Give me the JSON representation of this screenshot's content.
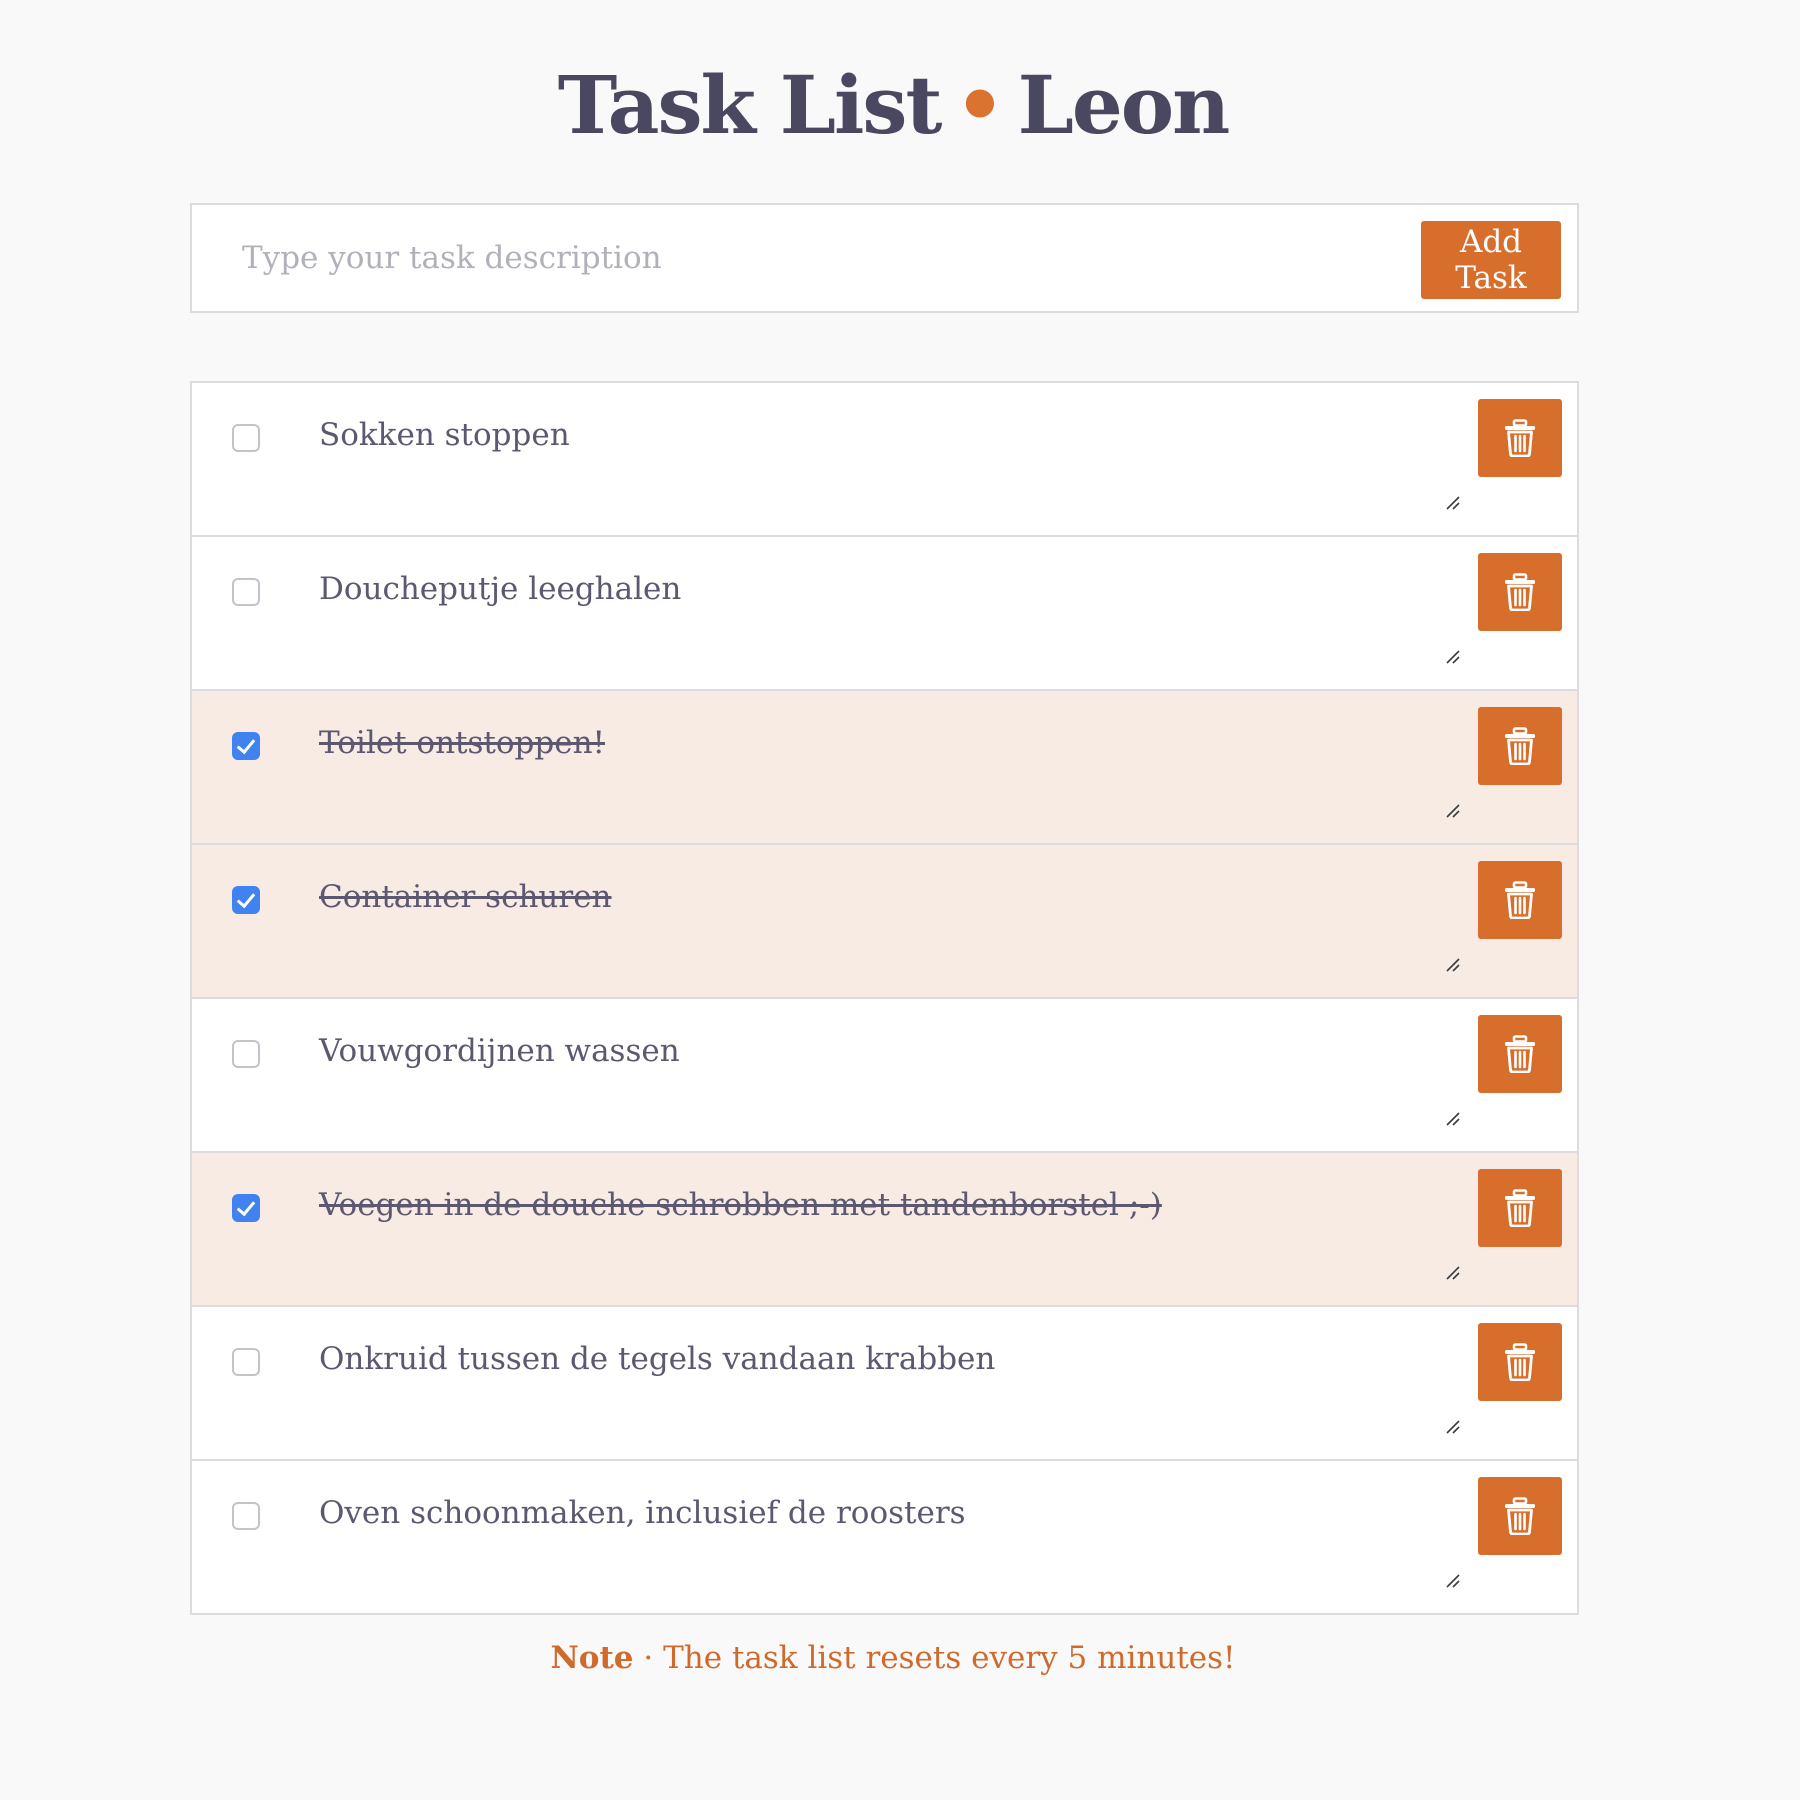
{
  "header": {
    "title_left": "Task List",
    "title_separator": "•",
    "title_right": "Leon"
  },
  "new_task": {
    "placeholder": "Type your task description",
    "value": "",
    "add_label": "Add Task"
  },
  "tasks": [
    {
      "text": "Sokken stoppen",
      "done": false
    },
    {
      "text": "Doucheputje leeghalen",
      "done": false
    },
    {
      "text": "Toilet ontstoppen!",
      "done": true
    },
    {
      "text": "Container schuren",
      "done": true
    },
    {
      "text": "Vouwgordijnen wassen",
      "done": false
    },
    {
      "text": "Voegen in de douche schrobben met tandenborstel ;-)",
      "done": true
    },
    {
      "text": "Onkruid tussen de tegels vandaan krabben",
      "done": false
    },
    {
      "text": "Oven schoonmaken, inclusief de roosters",
      "done": false
    }
  ],
  "icons": {
    "delete": "trash-icon",
    "grip": "resize-grip-icon",
    "check": "checkmark-icon"
  },
  "note": {
    "label": "Note",
    "separator": "·",
    "text": "The task list resets every 5 minutes!"
  },
  "colors": {
    "accent": "#d86e2c",
    "title": "#4a4860",
    "done_row": "#f7ebe4",
    "checkbox_checked": "#3f82f0"
  }
}
